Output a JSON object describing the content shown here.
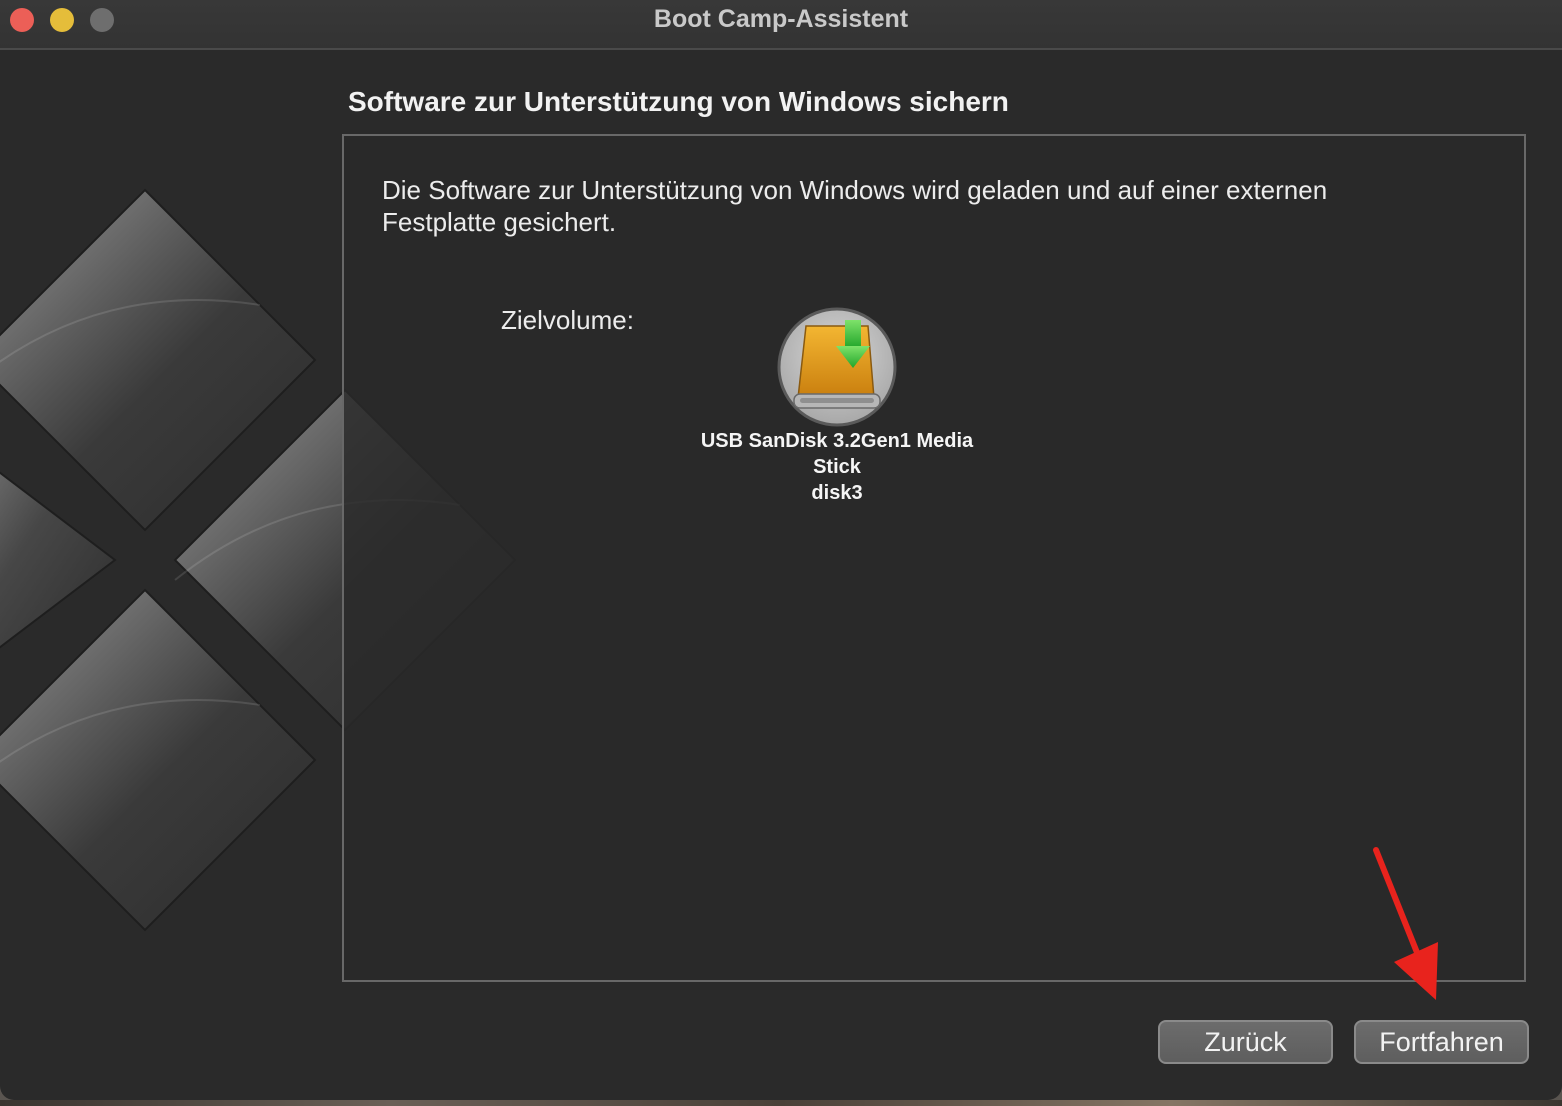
{
  "window": {
    "title": "Boot Camp-Assistent"
  },
  "page": {
    "heading": "Software zur Unterstützung von Windows sichern",
    "description": "Die Software zur Unterstützung von Windows wird geladen und auf einer externen Festplatte gesichert.",
    "target_label": "Zielvolume:",
    "volume": {
      "name_line1": "USB SanDisk 3.2Gen1 Media",
      "name_line2": "Stick",
      "device": "disk3",
      "icon": "external-drive-download-icon"
    }
  },
  "buttons": {
    "back_label": "Zurück",
    "continue_label": "Fortfahren"
  },
  "colors": {
    "window_bg": "#2a2a2a",
    "close": "#ec5f57",
    "minimize": "#e5bd3a",
    "maximize_inactive": "#6e6e6e",
    "annotation_arrow": "#e8231d",
    "drive_orange": "#e8a21a",
    "download_green": "#3cc43c"
  }
}
